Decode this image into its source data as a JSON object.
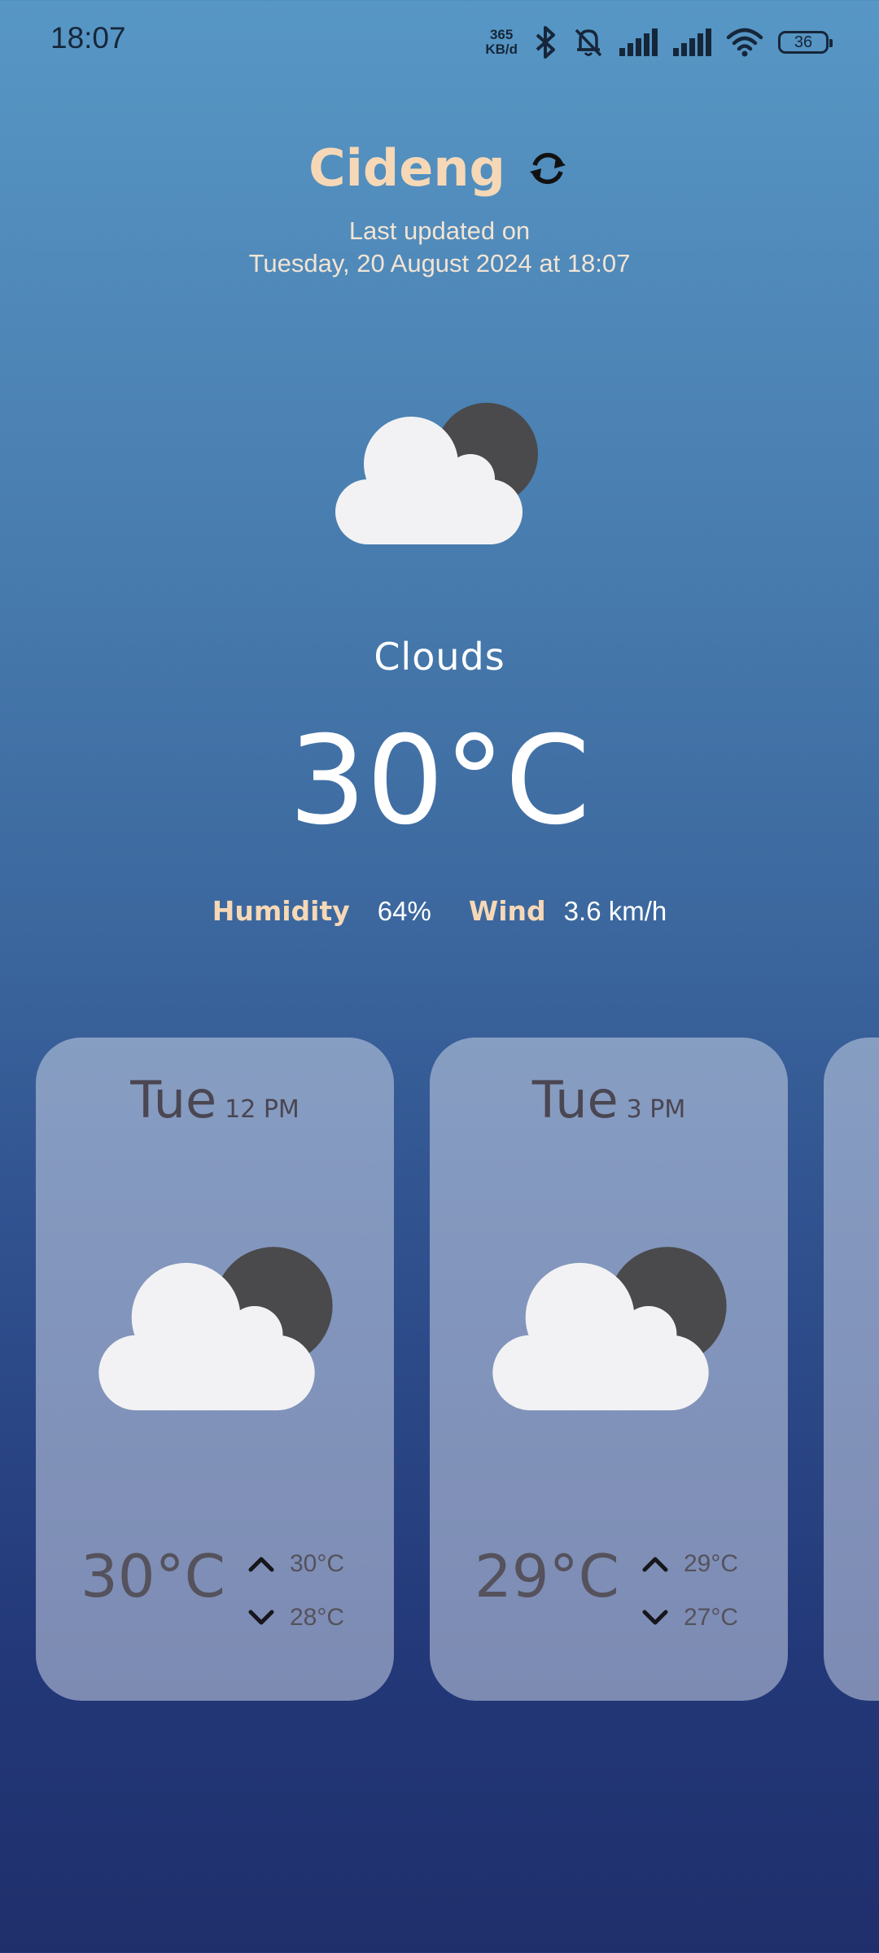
{
  "status_bar": {
    "time": "18:07",
    "net_speed_value": "365",
    "net_speed_unit": "KB/d",
    "battery": "36"
  },
  "header": {
    "city": "Cideng",
    "updated_line1": "Last updated on",
    "updated_line2": "Tuesday, 20 August 2024 at 18:07"
  },
  "current": {
    "condition": "Clouds",
    "temperature": "30°C",
    "icon": "cloud-moon-icon",
    "humidity_label": "Humidity",
    "humidity_value": "64%",
    "wind_label": "Wind",
    "wind_value": "3.6 km/h"
  },
  "forecast": [
    {
      "day": "Tue",
      "time": "12 PM",
      "temp": "30°C",
      "high": "30°C",
      "low": "28°C",
      "icon": "cloud-moon-icon"
    },
    {
      "day": "Tue",
      "time": "3 PM",
      "temp": "29°C",
      "high": "29°C",
      "low": "27°C",
      "icon": "cloud-moon-icon"
    }
  ],
  "colors": {
    "accent": "#f6d8b6",
    "moon": "#4a4a4c",
    "cloud": "#f2f2f4"
  }
}
